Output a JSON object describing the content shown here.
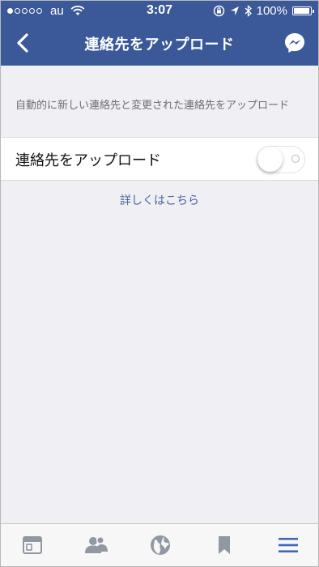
{
  "status_bar": {
    "carrier": "au",
    "time": "3:07",
    "battery_text": "100%",
    "battery_level": 1.0,
    "signal_dots": [
      true,
      false,
      false,
      false,
      false
    ]
  },
  "header": {
    "title": "連絡先をアップロード",
    "back_icon": "chevron-left-icon",
    "right_icon": "messenger-icon",
    "color": "#3b5998"
  },
  "section": {
    "description": "自動的に新しい連絡先と変更された連絡先をアップロード"
  },
  "setting": {
    "label": "連絡先をアップロード",
    "enabled": false
  },
  "help_link": "詳しくはこちら",
  "tabbar": {
    "tabs": [
      {
        "name": "news-feed",
        "icon": "news-feed-icon",
        "active": false
      },
      {
        "name": "friends",
        "icon": "friends-icon",
        "active": false
      },
      {
        "name": "notifications",
        "icon": "globe-icon",
        "active": false
      },
      {
        "name": "saved",
        "icon": "bookmark-icon",
        "active": false
      },
      {
        "name": "menu",
        "icon": "menu-icon",
        "active": true
      }
    ],
    "inactive_color": "#9197a3",
    "active_color": "#4267b2"
  }
}
